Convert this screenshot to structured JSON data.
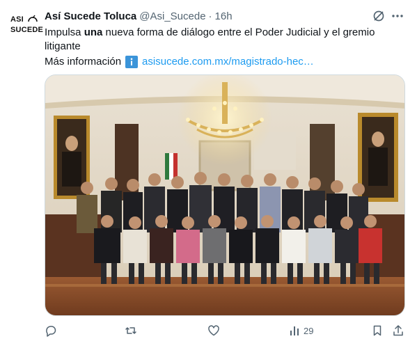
{
  "author": {
    "name": "Así Sucede Toluca",
    "handle": "@Asi_Sucede",
    "separator": "·",
    "time": "16h",
    "avatar_logo": [
      "ASI",
      "SUCEDE"
    ]
  },
  "tweet": {
    "text_before": "Impulsa ",
    "text_bold": "una",
    "text_after": " nueva forma de diálogo entre el Poder Judicial y el gremio litigante",
    "more_info_label": "Más información",
    "info_icon": "info-icon",
    "link": "asisucede.com.mx/magistrado-hec…"
  },
  "media": {
    "type": "photo",
    "alt_subject": "group-photo"
  },
  "actions": {
    "reply_icon": "reply-icon",
    "retweet_icon": "retweet-icon",
    "like_icon": "like-icon",
    "views_icon": "views-icon",
    "views": "29",
    "bookmark_icon": "bookmark-icon",
    "share_icon": "share-icon"
  },
  "colors": {
    "text": "#0f1419",
    "secondary": "#536471",
    "link": "#1d9bf0",
    "info_badge": "#3b94d9"
  }
}
